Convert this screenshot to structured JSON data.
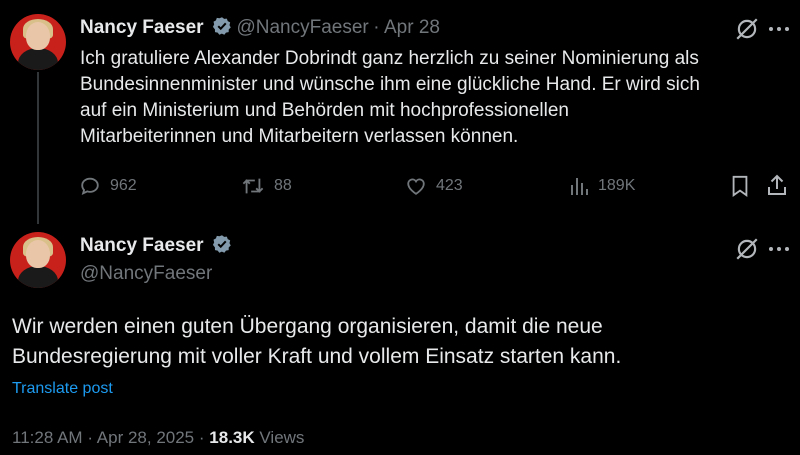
{
  "tweet1": {
    "name": "Nancy Faeser",
    "handle": "@NancyFaeser",
    "separator": "·",
    "date": "Apr 28",
    "text_lines": [
      "Ich gratuliere Alexander Dobrindt ganz herzlich zu seiner Nominierung als",
      "Bundesinnenminister und wünsche ihm eine glückliche Hand. Er wird sich",
      "auf ein Ministerium und Behörden mit hochprofessionellen",
      "Mitarbeiterinnen und Mitarbeitern verlassen können."
    ],
    "replies": "962",
    "reposts": "88",
    "likes": "423",
    "views": "189K"
  },
  "tweet2": {
    "name": "Nancy Faeser",
    "handle": "@NancyFaeser",
    "text_lines": [
      "Wir werden einen guten Übergang organisieren, damit die neue",
      "Bundesregierung mit voller Kraft und vollem Einsatz starten kann."
    ],
    "translate": "Translate post",
    "time": "11:28 AM",
    "dot": "·",
    "date": "Apr 28, 2025",
    "dot2": "·",
    "views_count": "18.3K",
    "views_label": "Views"
  },
  "colors": {
    "accent": "#1d9bf0",
    "muted": "#71767b",
    "text": "#e7e9ea",
    "bg": "#000000"
  },
  "icons": [
    "verified-badge-icon",
    "grok-icon",
    "more-icon",
    "reply-icon",
    "repost-icon",
    "like-icon",
    "views-icon",
    "bookmark-icon",
    "share-icon"
  ]
}
